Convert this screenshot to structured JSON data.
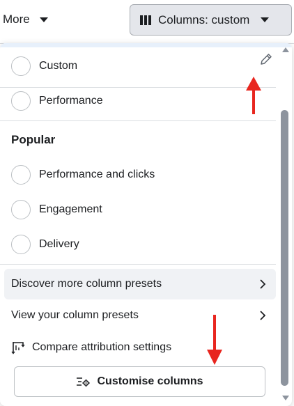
{
  "toolbar": {
    "more_label": "More",
    "columns_label": "Columns: custom"
  },
  "presets": {
    "custom_label": "Custom",
    "performance_label": "Performance"
  },
  "popular": {
    "title": "Popular",
    "items": [
      {
        "label": "Performance and clicks"
      },
      {
        "label": "Engagement"
      },
      {
        "label": "Delivery"
      }
    ]
  },
  "actions": {
    "discover_label": "Discover more column presets",
    "view_label": "View your column presets",
    "compare_label": "Compare attribution settings",
    "customise_label": "Customise columns"
  },
  "icons": {
    "columns": "columns-icon",
    "pencil": "pencil-icon",
    "chevron": "chevron-right-icon",
    "compare": "compare-attribution-icon",
    "customise": "settings-sliders-icon"
  },
  "colors": {
    "annotation_arrow": "#e8261f",
    "hover_row": "#f0f2f5",
    "columns_button_bg": "#e4e6eb"
  }
}
